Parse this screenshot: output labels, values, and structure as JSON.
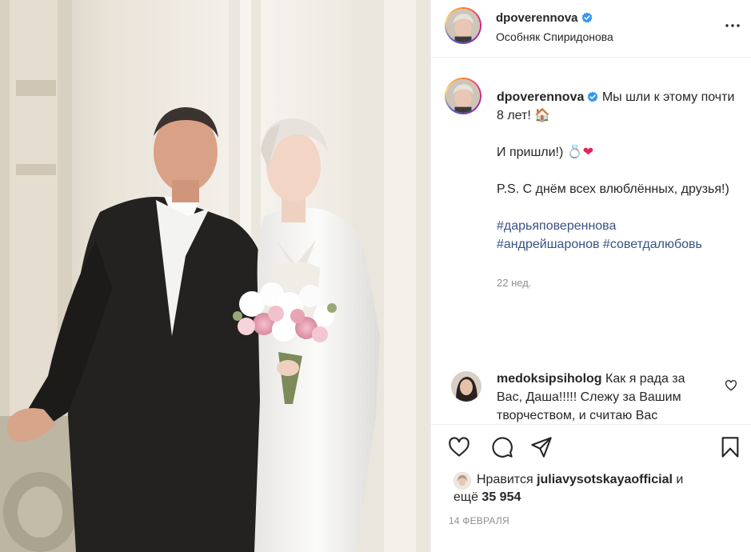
{
  "header": {
    "username": "dpoverennova",
    "location": "Особняк Спиридонова",
    "verified_icon": "verified-badge-icon",
    "more_icon": "more-options-icon"
  },
  "caption": {
    "username": "dpoverennova",
    "line1": "Мы шли к этому почти 8 лет!",
    "emoji1": "🏠",
    "line2": "И пришли!)",
    "emoji2": "💍❤",
    "line3": "P.S. С днём всех влюблённых, друзья!)",
    "hashtag1": "#дарьяповереннова",
    "hashtag2": "#андрейшаронов",
    "hashtag3": "#советдалюбовь",
    "time": "22 нед."
  },
  "comment": {
    "username": "medoksipsiholog",
    "text": "Как я рада за Вас, Даша!!!!! Слежу за Вашим творчеством, и считаю Вас"
  },
  "actions": {
    "like_icon": "heart-icon",
    "comment_icon": "comment-bubble-icon",
    "share_icon": "paper-plane-icon",
    "save_icon": "bookmark-icon"
  },
  "likes": {
    "prefix": "Нравится",
    "user": "juliavysotskayaofficial",
    "and": "и",
    "more_prefix": "ещё",
    "count": "35 954"
  },
  "date": "14 ФЕВРАЛЯ",
  "colors": {
    "text": "#262626",
    "muted": "#8e8e8e",
    "hashtag": "#385185",
    "verified": "#3897f0",
    "border": "#efefef"
  }
}
